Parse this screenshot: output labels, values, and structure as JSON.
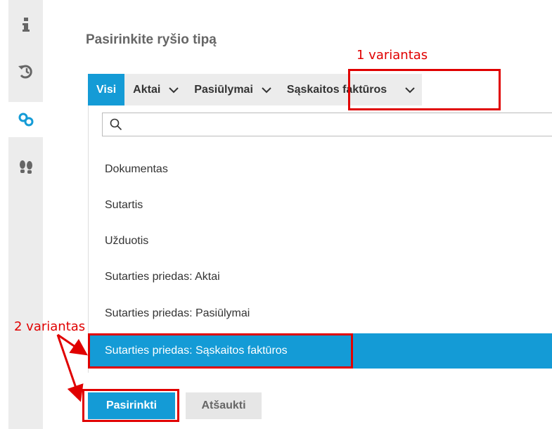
{
  "page": {
    "title": "Pasirinkite ryšio tipą"
  },
  "sidebar": {
    "items": [
      {
        "icon": "info-icon"
      },
      {
        "icon": "history-icon"
      },
      {
        "icon": "link-icon"
      },
      {
        "icon": "footprints-icon"
      }
    ],
    "active_index": 2
  },
  "tabs": [
    {
      "label": "Visi",
      "active": true,
      "has_chevron": false
    },
    {
      "label": "Aktai",
      "active": false,
      "has_chevron": true
    },
    {
      "label": "Pasiūlymai",
      "active": false,
      "has_chevron": true
    },
    {
      "label": "Sąskaitos faktūros",
      "active": false,
      "has_chevron": true
    }
  ],
  "search": {
    "value": "",
    "icon": "search-icon"
  },
  "list": {
    "items": [
      {
        "label": "Dokumentas",
        "selected": false
      },
      {
        "label": "Sutartis",
        "selected": false
      },
      {
        "label": "Užduotis",
        "selected": false
      },
      {
        "label": "Sutarties priedas: Aktai",
        "selected": false
      },
      {
        "label": "Sutarties priedas: Pasiūlymai",
        "selected": false
      },
      {
        "label": "Sutarties priedas: Sąskaitos faktūros",
        "selected": true
      }
    ]
  },
  "buttons": {
    "select_label": "Pasirinkti",
    "cancel_label": "Atšaukti"
  },
  "annotations": {
    "variant1": "1 variantas",
    "variant2": "2 variantas",
    "color": "#e00000"
  },
  "colors": {
    "accent": "#149bd6",
    "sidebar_bg": "#ececec",
    "tab_bg": "#ececec"
  }
}
